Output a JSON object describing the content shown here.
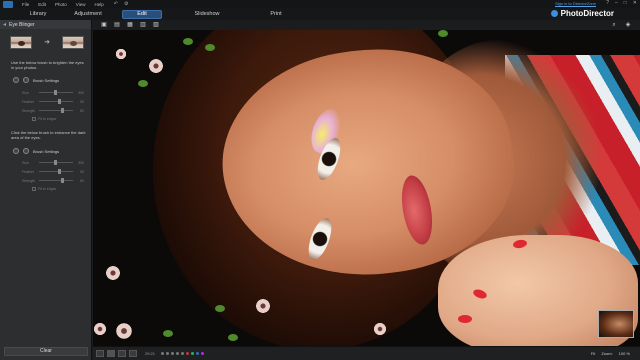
{
  "menu": {
    "items": [
      "File",
      "Edit",
      "Photo",
      "View",
      "Help"
    ],
    "sign_in": "Sign in to DirectorZone",
    "window_controls": [
      "?",
      "–",
      "□",
      "✕"
    ]
  },
  "modes": {
    "tabs": [
      "Library",
      "Adjustment",
      "Edit",
      "Slideshow",
      "Print"
    ],
    "active": "Edit"
  },
  "brand": {
    "name": "PhotoDirector"
  },
  "panel": {
    "title": "Eye Blinger",
    "section1_text": "Use the below brush to brighten the eyes in your photos.",
    "brush_settings_label": "Brush Settings",
    "sliders1": [
      {
        "label": "Size",
        "value": "300",
        "level": 0.45
      },
      {
        "label": "Feather",
        "value": "50",
        "level": 0.55
      },
      {
        "label": "Strength",
        "value": "80",
        "level": 0.65
      }
    ],
    "fit_edges_label": "Fit to edges",
    "section2_text": "Click the below brush to enhance the dark area of the eyes.",
    "sliders2": [
      {
        "label": "Size",
        "value": "300",
        "level": 0.45
      },
      {
        "label": "Feather",
        "value": "50",
        "level": 0.55
      },
      {
        "label": "Strength",
        "value": "80",
        "level": 0.65
      }
    ],
    "clear_label": "Clear"
  },
  "bottom": {
    "info": "29:21",
    "zoom_label": "Zoom:",
    "zoom_value": "100 %",
    "fit_label": "Fit"
  },
  "colors": {
    "accent": "#2a4e7a",
    "panel": "#2d2e30",
    "bg": "#1b1c1e"
  }
}
